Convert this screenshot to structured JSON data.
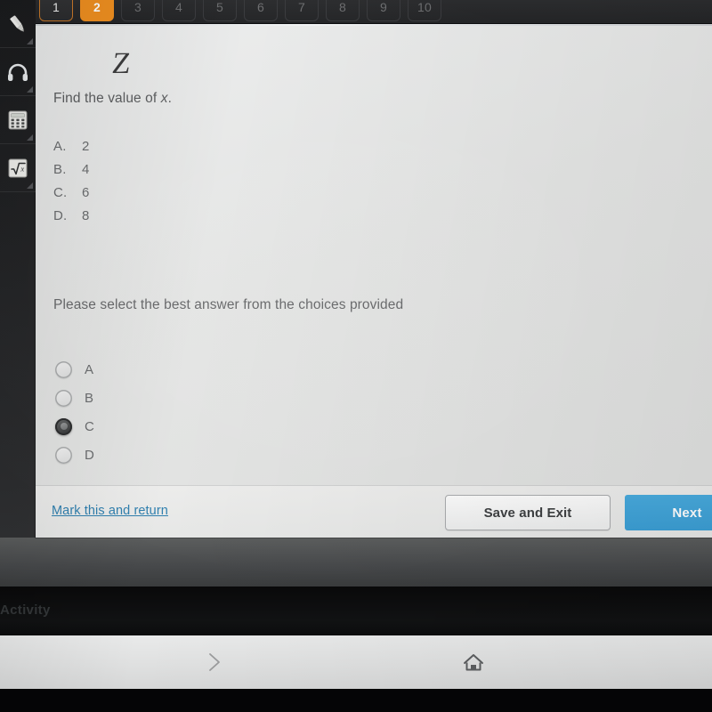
{
  "question_nav": {
    "name": "question-number-tabs",
    "tabs": [
      {
        "number": "1",
        "state": "visited"
      },
      {
        "number": "2",
        "state": "current"
      },
      {
        "number": "3",
        "state": "locked"
      },
      {
        "number": "4",
        "state": "locked"
      },
      {
        "number": "5",
        "state": "locked"
      },
      {
        "number": "6",
        "state": "locked"
      },
      {
        "number": "7",
        "state": "locked"
      },
      {
        "number": "8",
        "state": "locked"
      },
      {
        "number": "9",
        "state": "locked"
      },
      {
        "number": "10",
        "state": "locked"
      }
    ],
    "current_color": "#ef8f20",
    "visited_outline_color": "#c9792a"
  },
  "toolbar": {
    "tools": [
      {
        "icon": "highlighter-icon",
        "label": "Highlighter"
      },
      {
        "icon": "headphones-icon",
        "label": "Audio"
      },
      {
        "icon": "calculator-icon",
        "label": "Calculator"
      },
      {
        "icon": "square-root-icon",
        "label": "Formula"
      }
    ]
  },
  "question": {
    "figure_glyph": "Z",
    "prompt_prefix": "Find the value of ",
    "prompt_variable": "x",
    "prompt_suffix": ".",
    "choices": [
      {
        "letter": "A.",
        "value": "2"
      },
      {
        "letter": "B.",
        "value": "4"
      },
      {
        "letter": "C.",
        "value": "6"
      },
      {
        "letter": "D.",
        "value": "8"
      }
    ],
    "instruction": "Please select the best answer from the choices provided",
    "answers": [
      {
        "label": "A",
        "selected": false
      },
      {
        "label": "B",
        "selected": false
      },
      {
        "label": "C",
        "selected": true
      },
      {
        "label": "D",
        "selected": false
      }
    ]
  },
  "footer": {
    "mark_link": "Mark this and return",
    "save_label": "Save and Exit",
    "next_label": "Next",
    "link_color": "#2f7fae",
    "next_color": "#3b9ed4"
  },
  "system": {
    "background_text": "us Activity",
    "nav_forward_icon": "chevron-right-icon",
    "nav_home_icon": "home-icon"
  }
}
